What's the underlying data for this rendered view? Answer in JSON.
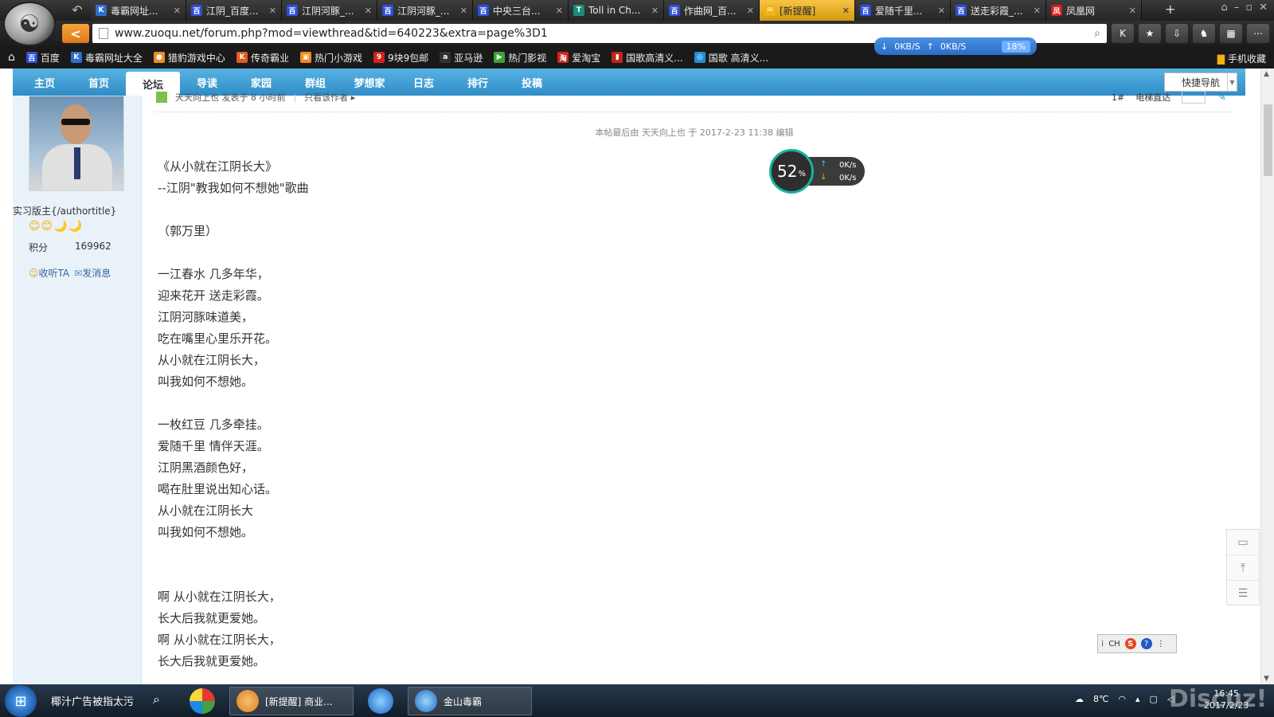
{
  "browser": {
    "tabs": [
      {
        "title": "毒霸网址...",
        "icon_color": "#2d6fd1",
        "icon": "K",
        "active": false
      },
      {
        "title": "江阴_百度...",
        "icon_color": "#2e4fd6",
        "icon": "百",
        "active": false
      },
      {
        "title": "江阴河豚_...",
        "icon_color": "#2e4fd6",
        "icon": "百",
        "active": false
      },
      {
        "title": "江阴河豚_...",
        "icon_color": "#2e4fd6",
        "icon": "百",
        "active": false
      },
      {
        "title": "中央三台...",
        "icon_color": "#2e4fd6",
        "icon": "百",
        "active": false
      },
      {
        "title": "Toll in Ch...",
        "icon_color": "#1b8c7a",
        "icon": "T",
        "active": false
      },
      {
        "title": "作曲网_百...",
        "icon_color": "#2e4fd6",
        "icon": "百",
        "active": false
      },
      {
        "title": "[新提醒]",
        "icon_color": "#f2b20f",
        "icon": "✉",
        "active": true
      },
      {
        "title": "爱随千里...",
        "icon_color": "#2e4fd6",
        "icon": "百",
        "active": false
      },
      {
        "title": "送走彩霞_...",
        "icon_color": "#2e4fd6",
        "icon": "百",
        "active": false
      },
      {
        "title": "凤凰网",
        "icon_color": "#d4201e",
        "icon": "凤",
        "active": false
      }
    ],
    "url": "www.zuoqu.net/forum.php?mod=viewthread&tid=640223&extra=page%3D1",
    "speed_pill": {
      "down": "0KB/S",
      "up": "0KB/S",
      "percent": "18%"
    },
    "bookmarks": [
      {
        "label": "百度",
        "icon_color": "#2e4fd6",
        "icon": "百"
      },
      {
        "label": "毒霸网址大全",
        "icon_color": "#2d6fd1",
        "icon": "K"
      },
      {
        "label": "猎豹游戏中心",
        "icon_color": "#f08a1c",
        "icon": "●"
      },
      {
        "label": "传奇霸业",
        "icon_color": "#e05a1c",
        "icon": "K"
      },
      {
        "label": "热门小游戏",
        "icon_color": "#f08a1c",
        "icon": "▣"
      },
      {
        "label": "9块9包邮",
        "icon_color": "#d4201e",
        "icon": "9"
      },
      {
        "label": "亚马逊",
        "icon_color": "#333333",
        "icon": "a"
      },
      {
        "label": "热门影视",
        "icon_color": "#3aa336",
        "icon": "▶"
      },
      {
        "label": "爱淘宝",
        "icon_color": "#d4201e",
        "icon": "淘"
      },
      {
        "label": "国歌高清义...",
        "icon_color": "#c2241c",
        "icon": "▮"
      },
      {
        "label": "国歌 高清义...",
        "icon_color": "#1f8fd6",
        "icon": "◎"
      }
    ],
    "bookmark_mobile": "手机收藏"
  },
  "forum_nav": {
    "items": [
      "主页",
      "首页",
      "论坛",
      "导读",
      "家园",
      "群组",
      "梦想家",
      "日志",
      "排行",
      "投稿"
    ],
    "active_index": 2,
    "quick_nav": "快捷导航"
  },
  "user": {
    "title": "实习版主{/authortitle}",
    "medals": "😊😊🌙🌙",
    "points_label": "积分",
    "points_value": "169962",
    "follow": "收听TA",
    "message": "发消息"
  },
  "post": {
    "author_line": "天天向上也 发表于 8 小时前",
    "only_author": "只看该作者",
    "floor": "1#",
    "elevator": "电梯直达",
    "edit_note": "本帖最后由 天天向上也 于 2017-2-23 11:38 编辑",
    "lines": [
      "《从小就在江阴长大》",
      "--江阴\"教我如何不想她\"歌曲",
      "",
      "  （郭万里）",
      "",
      "一江春水 几多年华，",
      "迎来花开 送走彩霞。",
      "江阴河豚味道美，",
      "吃在嘴里心里乐开花。",
      "从小就在江阴长大，",
      "叫我如何不想她。",
      "",
      "一枚红豆 几多牵挂。",
      "爱随千里 情伴天涯。",
      "江阴黑酒颜色好，",
      "喝在肚里说出知心话。",
      "从小就在江阴长大",
      "叫我如何不想她。",
      "",
      "",
      "啊 从小就在江阴长大，",
      "长大后我就更爱她。",
      "啊 从小就在江阴长大，",
      "长大后我就更爱她。"
    ]
  },
  "speed_widget": {
    "percent": "52",
    "percent_sign": "%",
    "up": "0K/s",
    "down": "0K/s"
  },
  "ime": {
    "label": "CH"
  },
  "taskbar": {
    "search_text": "椰汁广告被指太污",
    "tasks": [
      {
        "label": "[新提醒] 商业...",
        "icon_color": "#f08a1c"
      },
      {
        "label": "金山毒霸",
        "icon_color": "#1f8fd6"
      }
    ],
    "temperature": "8℃",
    "time": "16:45",
    "date": "2017/2/23"
  },
  "watermark": "Discuz!"
}
